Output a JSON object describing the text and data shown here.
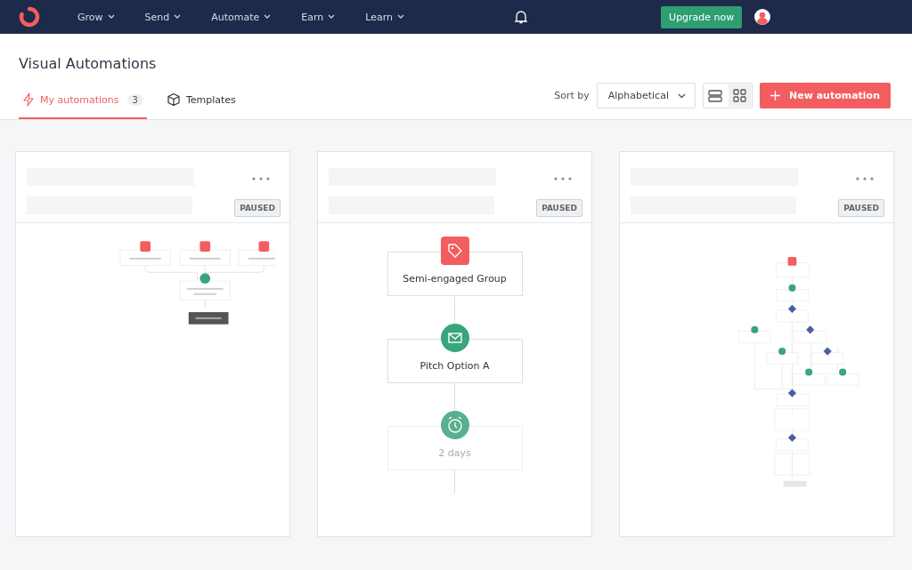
{
  "nav": {
    "items": [
      {
        "label": "Grow"
      },
      {
        "label": "Send"
      },
      {
        "label": "Automate"
      },
      {
        "label": "Earn"
      },
      {
        "label": "Learn"
      }
    ],
    "upgrade": "Upgrade now"
  },
  "page": {
    "title": "Visual Automations"
  },
  "tabs": [
    {
      "label": "My automations",
      "count": "3",
      "selected": true,
      "kind": "bolt"
    },
    {
      "label": "Templates",
      "selected": false,
      "kind": "cube"
    }
  ],
  "sort": {
    "label": "Sort by",
    "value": "Alphabetical"
  },
  "views": [
    {
      "kind": "list",
      "selected": false
    },
    {
      "kind": "grid",
      "selected": true
    }
  ],
  "new_button": "New automation",
  "cards": [
    {
      "status": "PAUSED",
      "kind": "thumb-small"
    },
    {
      "status": "PAUSED",
      "kind": "flow",
      "nodes": [
        {
          "label": "Semi-engaged Group",
          "kind": "tag",
          "faded": false
        },
        {
          "label": "Pitch Option A",
          "kind": "mail",
          "faded": false
        },
        {
          "label": "2 days",
          "kind": "clock",
          "faded": true
        }
      ]
    },
    {
      "status": "PAUSED",
      "kind": "thumb-tall"
    }
  ]
}
